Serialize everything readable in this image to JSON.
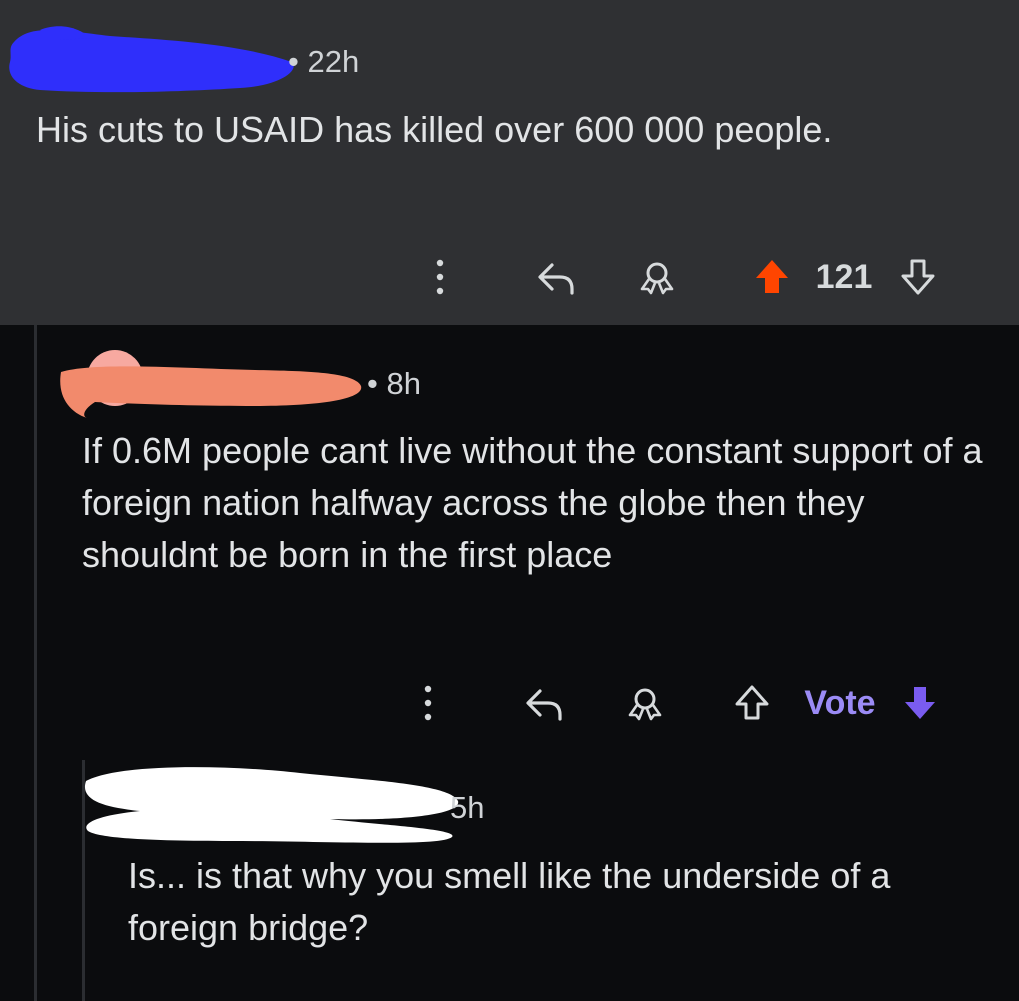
{
  "comments": [
    {
      "time": "22h",
      "body": "His cuts to USAID has killed over 600 000 people.",
      "score": "121",
      "author_redaction_color": "#2f2ffb"
    },
    {
      "time": "8h",
      "body": "If 0.6M people cant live without the constant support of a foreign nation halfway across the globe then they shouldnt be born in the first place",
      "vote_label": "Vote",
      "author_redaction_color": "#f28a6c"
    },
    {
      "time": "5h",
      "body": "Is... is that why you smell like the underside of a foreign bridge?",
      "author_redaction_color": "#ffffff"
    }
  ],
  "colors": {
    "upvote_active": "#ff4500",
    "downvote_active": "#7a5cf0",
    "vote_label": "#9b8bf5"
  },
  "icons": [
    "more-vertical-icon",
    "reply-icon",
    "award-icon",
    "upvote-icon",
    "downvote-icon"
  ]
}
